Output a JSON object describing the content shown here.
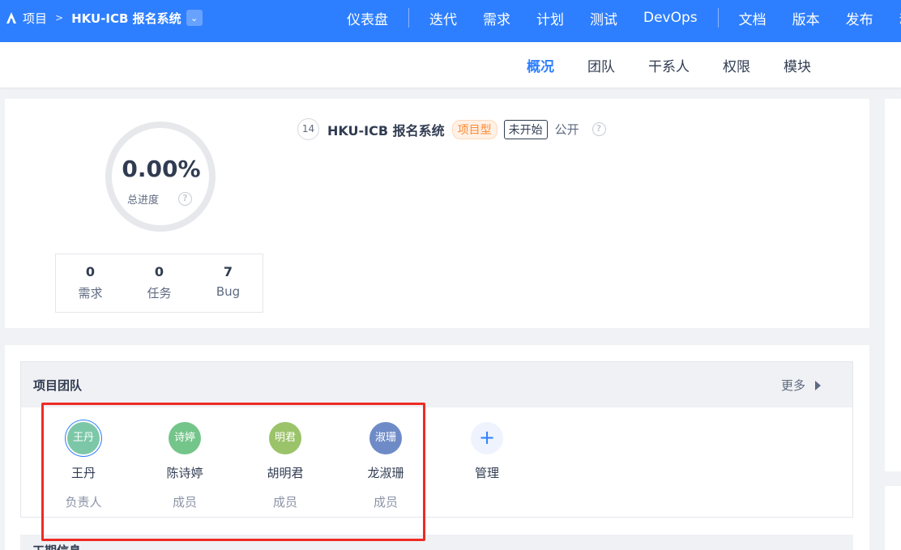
{
  "topbar": {
    "module_label": "项目",
    "product_name": "HKU-ICB 报名系统",
    "nav": [
      "仪表盘",
      "迭代",
      "需求",
      "计划",
      "测试",
      "DevOps",
      "文档",
      "版本",
      "发布"
    ],
    "overflow_char": "动",
    "bg_color": "#2e7fff"
  },
  "subnav": {
    "tabs": [
      "概况",
      "团队",
      "干系人",
      "权限",
      "模块"
    ],
    "active": "概况"
  },
  "overview": {
    "progress_value": "0.00%",
    "progress_label": "总进度",
    "help_icon": "question-icon",
    "stats": [
      {
        "value": "0",
        "label": "需求"
      },
      {
        "value": "0",
        "label": "任务"
      },
      {
        "value": "7",
        "label": "Bug"
      }
    ],
    "project": {
      "id": "14",
      "name": "HKU-ICB 报名系统",
      "type_badge": "项目型",
      "status_badge": "未开始",
      "visibility": "公开"
    }
  },
  "team": {
    "title": "项目团队",
    "more_label": "更多",
    "members": [
      {
        "avatar_text": "王丹",
        "name": "王丹",
        "role": "负责人",
        "color": "#7cc7a7"
      },
      {
        "avatar_text": "诗婷",
        "name": "陈诗婷",
        "role": "成员",
        "color": "#74c58a"
      },
      {
        "avatar_text": "明君",
        "name": "胡明君",
        "role": "成员",
        "color": "#9bc36a"
      },
      {
        "avatar_text": "淑珊",
        "name": "龙淑珊",
        "role": "成员",
        "color": "#6f8bc7"
      }
    ],
    "manage_label": "管理",
    "manage_icon": "plus-icon"
  },
  "next_section": {
    "title": "工期信息"
  },
  "highlight_color": "#ee2b24"
}
